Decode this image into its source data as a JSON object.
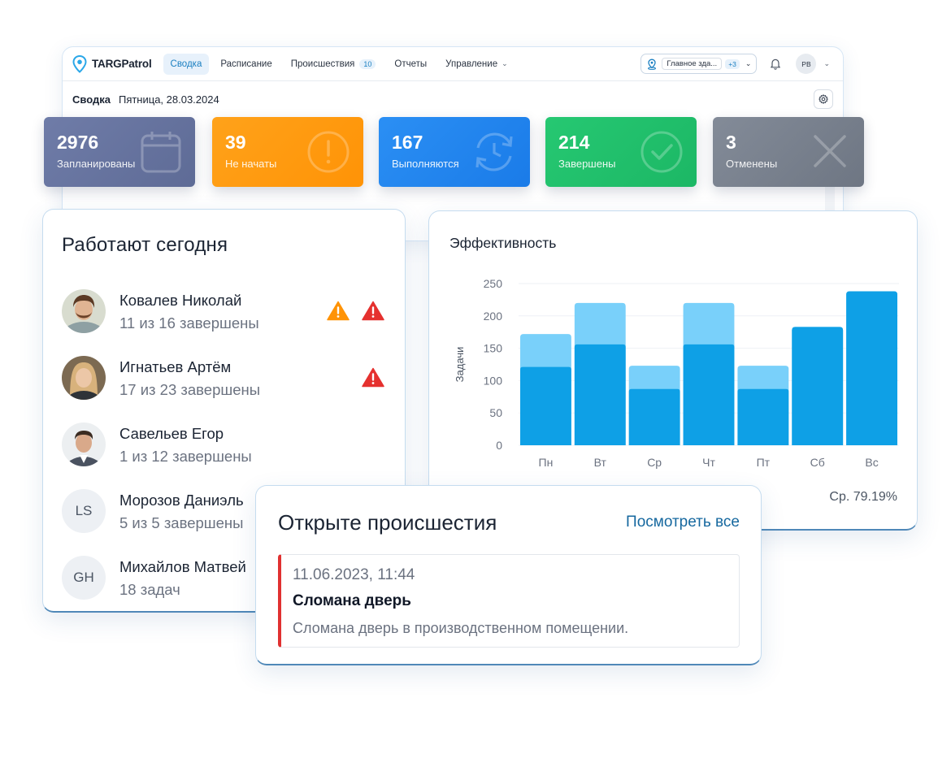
{
  "app": {
    "logo_text": "TARGPatrol",
    "nav": [
      {
        "label": "Сводка",
        "active": true
      },
      {
        "label": "Расписание"
      },
      {
        "label": "Происшествия",
        "badge": "10"
      },
      {
        "label": "Отчеты"
      },
      {
        "label": "Управление",
        "has_dropdown": true
      }
    ],
    "location": {
      "name": "Главное зда...",
      "more": "+3"
    },
    "user_initials": "PB"
  },
  "summary": {
    "title": "Сводка",
    "date": "Пятница, 28.03.2024"
  },
  "stats": [
    {
      "value": "2976",
      "label": "Запланированы",
      "color": "#6a77a3",
      "icon": "calendar-icon"
    },
    {
      "value": "39",
      "label": "Не начаты",
      "color": "#ff9a0d",
      "icon": "exclamation-circle-icon"
    },
    {
      "value": "167",
      "label": "Выполняются",
      "color": "#1f87f2",
      "icon": "refresh-clock-icon"
    },
    {
      "value": "214",
      "label": "Завершены",
      "color": "#1fbf6a",
      "icon": "check-circle-icon"
    },
    {
      "value": "3",
      "label": "Отменены",
      "color": "#77808f",
      "icon": "x-icon"
    }
  ],
  "workers": {
    "title": "Работают сегодня",
    "items": [
      {
        "name": "Ковалев Николай",
        "progress": "11 из 16 завершены",
        "warnings": [
          "warning-orange",
          "warning-red"
        ]
      },
      {
        "name": "Игнатьев Артём",
        "progress": "17 из 23 завершены",
        "warnings": [
          "warning-red"
        ]
      },
      {
        "name": "Савельев Егор",
        "progress": "1 из 12 завершены",
        "warnings": []
      },
      {
        "name": "Морозов Даниэль",
        "initials": "LS",
        "progress": "5 из 5 завершены",
        "warnings": []
      },
      {
        "name": "Михайлов Матвей",
        "initials": "GH",
        "progress": "18 задач",
        "warnings": []
      }
    ]
  },
  "efficiency": {
    "title": "Эффективность",
    "average": "Ср. 79.19%"
  },
  "chart_data": {
    "type": "bar",
    "title": "Эффективность",
    "ylabel": "Задачи",
    "xlabel": "",
    "ylim": [
      0,
      250
    ],
    "yticks": [
      0,
      50,
      100,
      150,
      200,
      250
    ],
    "categories": [
      "Пн",
      "Вт",
      "Ср",
      "Чт",
      "Пт",
      "Сб",
      "Вс"
    ],
    "series": [
      {
        "values": [
          121,
          156,
          87,
          156,
          87,
          183,
          238
        ],
        "color": "#0ea0e6"
      },
      {
        "values": [
          172,
          220,
          123,
          220,
          123,
          183,
          238
        ],
        "color": "#79d0fa"
      }
    ],
    "stacking": "overlay",
    "grid": true
  },
  "incidents": {
    "title": "Открыте происшестия",
    "view_all": "Посмотреть все",
    "items": [
      {
        "datetime": "11.06.2023, 11:44",
        "title": "Сломана дверь",
        "description": "Сломана дверь в производственном помещении.",
        "severity_color": "#e03131"
      }
    ]
  }
}
